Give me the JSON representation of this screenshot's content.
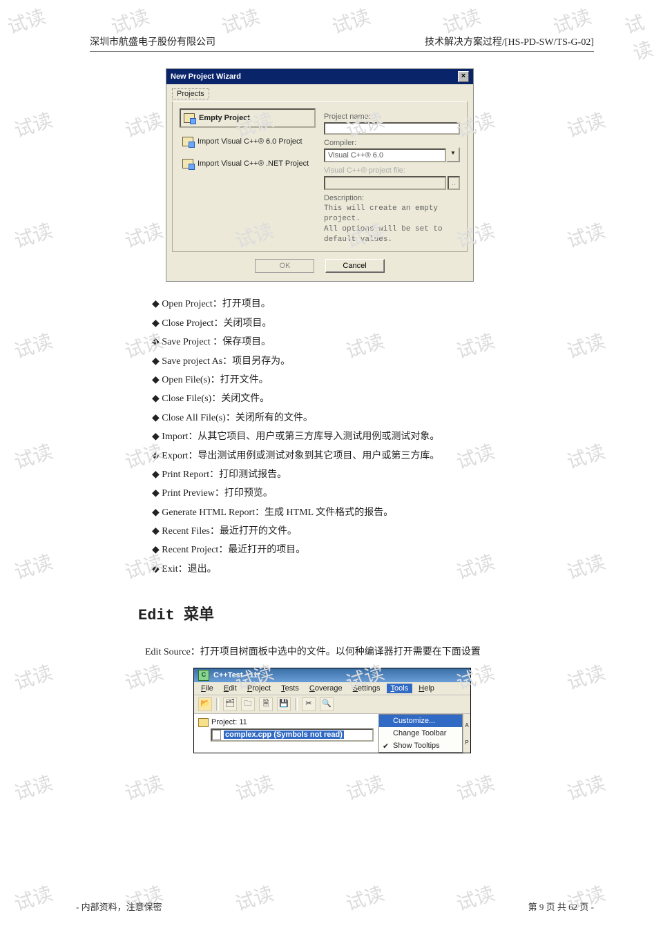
{
  "header": {
    "left": "深圳市航盛电子股份有限公司",
    "right": "技术解决方案过程/[HS-PD-SW/TS-G-02]"
  },
  "watermark": "试读",
  "dialog": {
    "title": "New Project Wizard",
    "tab": "Projects",
    "projects": [
      "Empty Project",
      "Import Visual C++® 6.0 Project",
      "Import Visual C++® .NET Project"
    ],
    "labels": {
      "pname": "Project name:",
      "compiler": "Compiler:",
      "vcfile": "Visual C++® project file:",
      "desc": "Description:"
    },
    "compiler_value": "Visual C++® 6.0",
    "desc_text": "This will create an empty\nproject.\nAll options will be set to\ndefault values.",
    "ok": "OK",
    "cancel": "Cancel"
  },
  "bullets": [
    {
      "t": "Open Project",
      "c": "：打开项目。"
    },
    {
      "t": "Close Project",
      "c": "：关闭项目。"
    },
    {
      "t": "Save Project",
      "c": " ：保存项目。"
    },
    {
      "t": "Save project As",
      "c": "：项目另存为。"
    },
    {
      "t": "Open File(s)",
      "c": "：打开文件。"
    },
    {
      "t": "Close File(s)",
      "c": "：关闭文件。"
    },
    {
      "t": "Close All File(s)",
      "c": "：关闭所有的文件。"
    },
    {
      "t": "Import",
      "c": "：从其它项目、用户或第三方库导入测试用例或测试对象。"
    },
    {
      "t": "Export",
      "c": "：导出测试用例或测试对象到其它项目、用户或第三方库。"
    },
    {
      "t": "Print Report",
      "c": "：打印测试报告。"
    },
    {
      "t": "Print Preview",
      "c": "：打印预览。"
    },
    {
      "t": "Generate HTML Report",
      "c": "：生成 HTML 文件格式的报告。"
    },
    {
      "t": "Recent Files",
      "c": "：最近打开的文件。"
    },
    {
      "t": "Recent Project",
      "c": "：最近打开的项目。"
    },
    {
      "t": "Exit",
      "c": "：退出。"
    }
  ],
  "heading": "Edit 菜单",
  "lead": "Edit Source：打开项目树面板中选中的文件。以何种编译器打开需要在下面设置",
  "win": {
    "title": "C++Test - 11*",
    "menus": [
      "File",
      "Edit",
      "Project",
      "Tests",
      "Coverage",
      "Settings",
      "Tools",
      "Help"
    ],
    "menu_underline": [
      0,
      0,
      0,
      0,
      0,
      0,
      0,
      0
    ],
    "tree_root": "Project: 11",
    "tree_child": "complex.cpp (Symbols not read)",
    "dropdown": [
      "Customize...",
      "Change Toolbar",
      "Show Tooltips"
    ]
  },
  "footer": {
    "left": "- 内部资料，注意保密",
    "right": "第 9 页 共 62 页 -"
  }
}
